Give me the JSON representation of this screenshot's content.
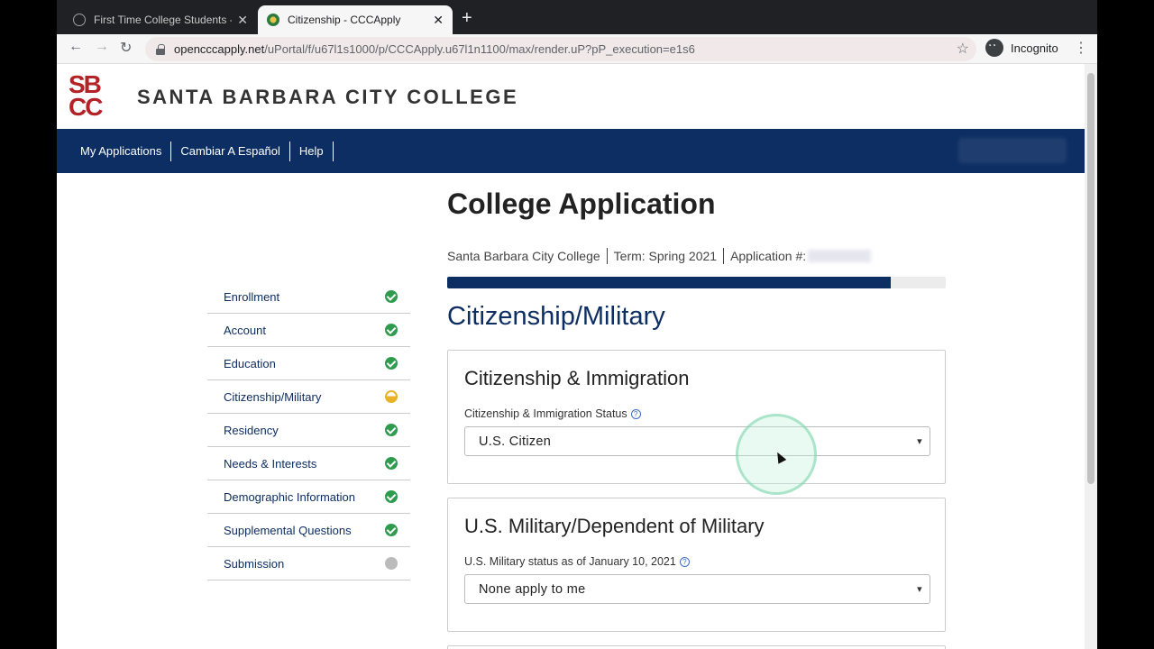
{
  "browser": {
    "tabs": [
      {
        "title": "First Time College Students - S",
        "active": false
      },
      {
        "title": "Citizenship - CCCApply",
        "active": true
      }
    ],
    "url_host": "opencccapply.net",
    "url_path": "/uPortal/f/u67l1s1000/p/CCCApply.u67l1n1100/max/render.uP?pP_execution=e1s6",
    "profile_label": "Incognito"
  },
  "header": {
    "logo_text": [
      "SB",
      "CC"
    ],
    "college_name": "SANTA BARBARA CITY COLLEGE"
  },
  "nav": {
    "links": [
      "My Applications",
      "Cambiar A Español",
      "Help"
    ]
  },
  "steps": [
    {
      "label": "Enrollment",
      "status": "complete"
    },
    {
      "label": "Account",
      "status": "complete"
    },
    {
      "label": "Education",
      "status": "complete"
    },
    {
      "label": "Citizenship/Military",
      "status": "in-progress"
    },
    {
      "label": "Residency",
      "status": "complete"
    },
    {
      "label": "Needs & Interests",
      "status": "complete"
    },
    {
      "label": "Demographic Information",
      "status": "complete"
    },
    {
      "label": "Supplemental Questions",
      "status": "complete"
    },
    {
      "label": "Submission",
      "status": "pending"
    }
  ],
  "main": {
    "title": "College Application",
    "college": "Santa Barbara City College",
    "term": "Term: Spring 2021",
    "application_label": "Application #:",
    "progress_fraction": 0.89,
    "section_title": "Citizenship/Military"
  },
  "citizenship_card": {
    "heading": "Citizenship & Immigration",
    "field_label": "Citizenship & Immigration Status",
    "selected_value": "U.S. Citizen"
  },
  "military_card": {
    "heading": "U.S. Military/Dependent of Military",
    "field_label": "U.S. Military status as of January 10, 2021",
    "selected_value": "None apply to me"
  },
  "colors": {
    "navy": "#0d2e63",
    "brand_red": "#b32226",
    "complete_green": "#2e9b4e",
    "in_progress_yellow": "#e9b227"
  }
}
